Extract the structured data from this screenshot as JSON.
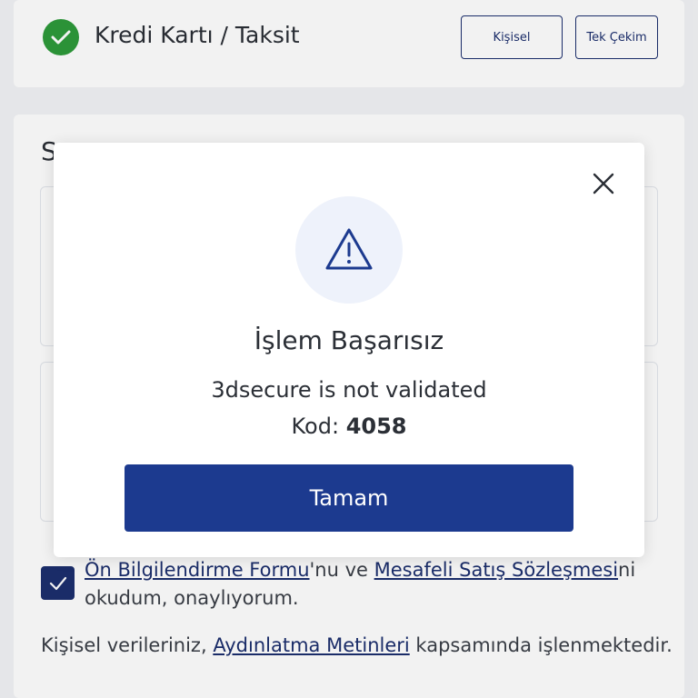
{
  "header": {
    "title": "Kredi Kartı / Taksit",
    "buttons": {
      "kisisel": "Kişisel",
      "tek_cekim": "Tek Çekim"
    }
  },
  "main": {
    "section_letter": "S",
    "agreement": {
      "link1": "Ön Bilgilendirme Formu",
      "mid": "'nu ve ",
      "link2": "Mesafeli Satış Sözleşmesi",
      "end": "ni okudum, onaylıyorum."
    },
    "kvkk": {
      "before": "Kişisel verileriniz, ",
      "link": "Aydınlatma Metinleri",
      "after": " kapsamında işlenmektedir."
    }
  },
  "modal": {
    "title": "İşlem Başarısız",
    "message": "3dsecure is not validated",
    "code_label": "Kod:",
    "code_value": "4058",
    "ok_label": "Tamam"
  },
  "colors": {
    "primary": "#1c3a8f",
    "success": "#2e9a3a",
    "navy": "#1c2f6e"
  },
  "icons": [
    "check-icon",
    "close-icon",
    "warning-icon"
  ]
}
